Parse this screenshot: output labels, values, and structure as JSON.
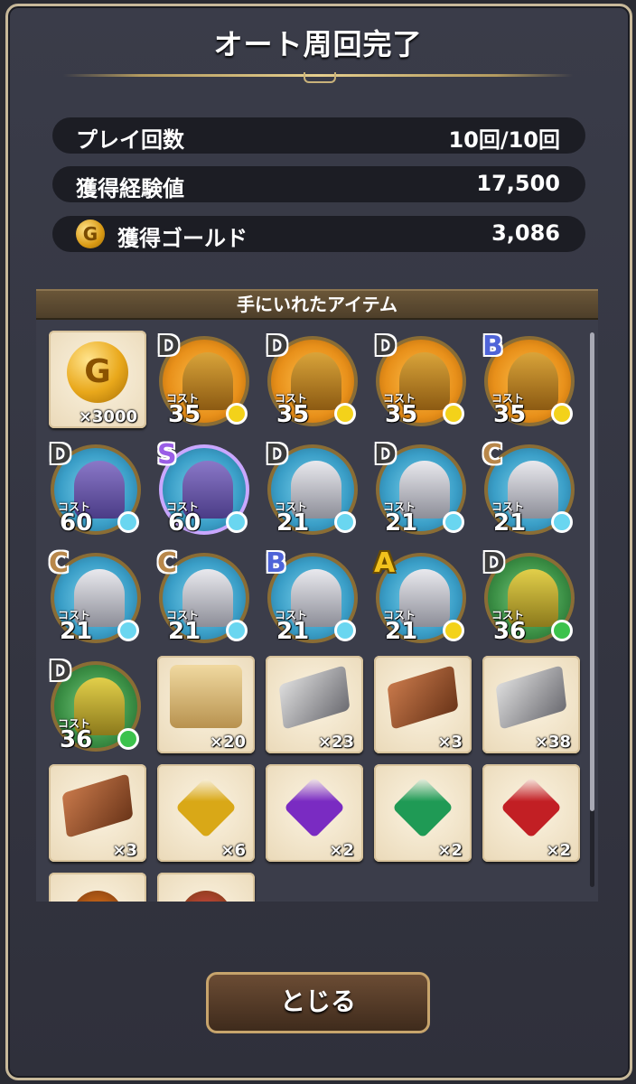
{
  "title": "オート周回完了",
  "stats": {
    "play_count": {
      "label": "プレイ回数",
      "value": "10回/10回"
    },
    "exp": {
      "label": "獲得経験値",
      "value": "17,500"
    },
    "gold": {
      "label": "獲得ゴールド",
      "value": "3,086",
      "icon": "G"
    }
  },
  "section_title": "手にいれたアイテム",
  "cost_label": "コスト",
  "items": {
    "r1": [
      {
        "kind": "coin",
        "icon": "G",
        "qty": "×3000"
      },
      {
        "kind": "monster",
        "rank": "D",
        "cost": "35",
        "theme": "orange",
        "figure": "scorpion",
        "gem_color": "#f3d21a"
      },
      {
        "kind": "monster",
        "rank": "D",
        "cost": "35",
        "theme": "orange",
        "figure": "scorpion",
        "gem_color": "#f3d21a"
      },
      {
        "kind": "monster",
        "rank": "D",
        "cost": "35",
        "theme": "orange",
        "figure": "scorpion",
        "gem_color": "#f3d21a"
      },
      {
        "kind": "monster",
        "rank": "B",
        "cost": "35",
        "theme": "orange",
        "figure": "scorpion",
        "gem_color": "#f3d21a"
      }
    ],
    "r2": [
      {
        "kind": "monster",
        "rank": "D",
        "cost": "60",
        "theme": "blue",
        "figure": "mummy",
        "gem_color": "#6ad6f0"
      },
      {
        "kind": "monster",
        "rank": "S",
        "cost": "60",
        "theme": "blue",
        "figure": "mummy",
        "gem_color": "#6ad6f0"
      },
      {
        "kind": "monster",
        "rank": "D",
        "cost": "21",
        "theme": "blue",
        "figure": "skeleton",
        "gem_color": "#6ad6f0"
      },
      {
        "kind": "monster",
        "rank": "D",
        "cost": "21",
        "theme": "blue",
        "figure": "skeleton",
        "gem_color": "#6ad6f0"
      },
      {
        "kind": "monster",
        "rank": "C",
        "cost": "21",
        "theme": "blue",
        "figure": "skeleton",
        "gem_color": "#6ad6f0"
      }
    ],
    "r3": [
      {
        "kind": "monster",
        "rank": "C",
        "cost": "21",
        "theme": "blue",
        "figure": "skeleton",
        "gem_color": "#6ad6f0"
      },
      {
        "kind": "monster",
        "rank": "C",
        "cost": "21",
        "theme": "blue",
        "figure": "skeleton",
        "gem_color": "#6ad6f0"
      },
      {
        "kind": "monster",
        "rank": "B",
        "cost": "21",
        "theme": "blue",
        "figure": "skeleton",
        "gem_color": "#6ad6f0"
      },
      {
        "kind": "monster",
        "rank": "A",
        "cost": "21",
        "theme": "blue",
        "figure": "skeleton",
        "gem_color": "#f3d21a"
      },
      {
        "kind": "monster",
        "rank": "D",
        "cost": "36",
        "theme": "green",
        "figure": "elf",
        "gem_color": "#3cc24c"
      }
    ],
    "r4": [
      {
        "kind": "monster",
        "rank": "D",
        "cost": "36",
        "theme": "green",
        "figure": "elf",
        "gem_color": "#3cc24c"
      },
      {
        "kind": "item",
        "shape": "scroll",
        "qty": "×20"
      },
      {
        "kind": "item",
        "shape": "ingot-gray-sword",
        "qty": "×23"
      },
      {
        "kind": "item",
        "shape": "ingot-brown-sword",
        "qty": "×3"
      },
      {
        "kind": "item",
        "shape": "ingot-gray-shield",
        "qty": "×38"
      }
    ],
    "r5": [
      {
        "kind": "item",
        "shape": "ingot-brown-shield",
        "qty": "×3"
      },
      {
        "kind": "item",
        "shape": "crystal-yellow",
        "color": "#d9a817",
        "qty": "×6"
      },
      {
        "kind": "item",
        "shape": "crystal-purple",
        "color": "#7a2bc2",
        "qty": "×2"
      },
      {
        "kind": "item",
        "shape": "crystal-green",
        "color": "#1f9a55",
        "qty": "×2"
      },
      {
        "kind": "item",
        "shape": "crystal-red",
        "color": "#c21f24",
        "qty": "×2"
      }
    ],
    "r6": [
      {
        "kind": "item",
        "shape": "emblem-orange",
        "color": "#e8781a"
      },
      {
        "kind": "item",
        "shape": "emblem-red",
        "color": "#d84a4a"
      }
    ]
  },
  "close_button": "とじる",
  "colors": {
    "frame": "#c8b99a",
    "button_border": "#c7a46c"
  }
}
